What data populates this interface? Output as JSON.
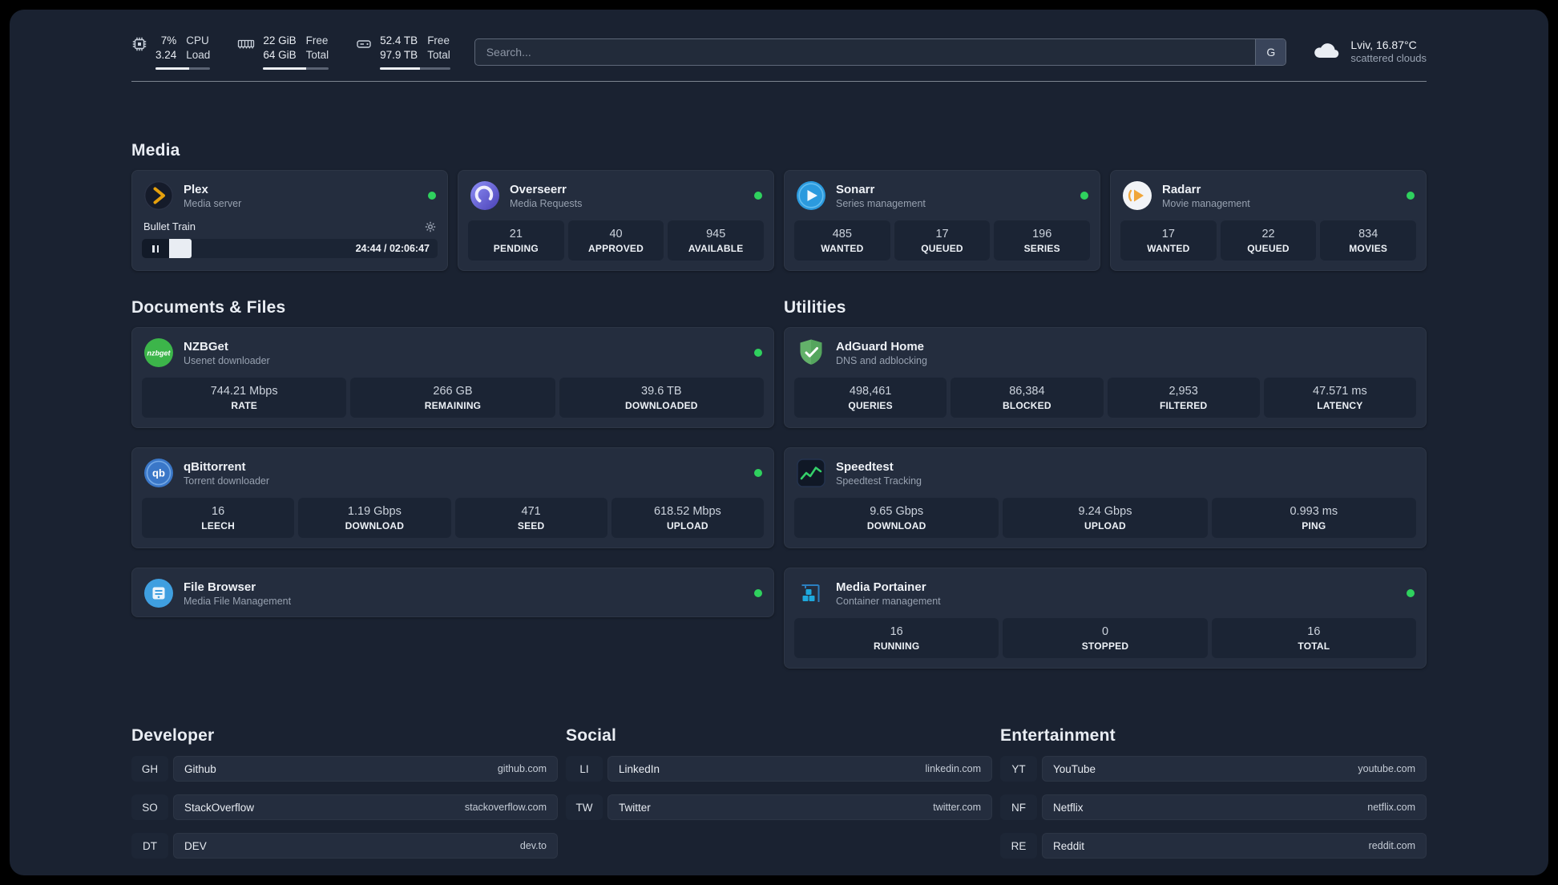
{
  "topbar": {
    "cpu": {
      "value_top": "7%",
      "value_bottom": "3.24",
      "label_top": "CPU",
      "label_bottom": "Load"
    },
    "memory": {
      "value_top": "22 GiB",
      "value_bottom": "64 GiB",
      "label_top": "Free",
      "label_bottom": "Total"
    },
    "disk": {
      "value_top": "52.4 TB",
      "value_bottom": "97.9 TB",
      "label_top": "Free",
      "label_bottom": "Total"
    },
    "search": {
      "placeholder": "Search...",
      "provider_button": "G"
    },
    "weather": {
      "location": "Lviv, 16.87°C",
      "condition": "scattered clouds"
    }
  },
  "media": {
    "title": "Media",
    "plex": {
      "name": "Plex",
      "description": "Media server",
      "now_playing": "Bullet Train",
      "progress_time": "24:44 / 02:06:47"
    },
    "overseerr": {
      "name": "Overseerr",
      "description": "Media Requests",
      "stats": [
        {
          "value": "21",
          "label": "PENDING"
        },
        {
          "value": "40",
          "label": "APPROVED"
        },
        {
          "value": "945",
          "label": "AVAILABLE"
        }
      ]
    },
    "sonarr": {
      "name": "Sonarr",
      "description": "Series management",
      "stats": [
        {
          "value": "485",
          "label": "WANTED"
        },
        {
          "value": "17",
          "label": "QUEUED"
        },
        {
          "value": "196",
          "label": "SERIES"
        }
      ]
    },
    "radarr": {
      "name": "Radarr",
      "description": "Movie management",
      "stats": [
        {
          "value": "17",
          "label": "WANTED"
        },
        {
          "value": "22",
          "label": "QUEUED"
        },
        {
          "value": "834",
          "label": "MOVIES"
        }
      ]
    }
  },
  "documents": {
    "title": "Documents & Files",
    "nzbget": {
      "name": "NZBGet",
      "description": "Usenet downloader",
      "icon_text": "nzbget",
      "stats": [
        {
          "value": "744.21 Mbps",
          "label": "RATE"
        },
        {
          "value": "266 GB",
          "label": "REMAINING"
        },
        {
          "value": "39.6 TB",
          "label": "DOWNLOADED"
        }
      ]
    },
    "qbittorrent": {
      "name": "qBittorrent",
      "description": "Torrent downloader",
      "icon_text": "qb",
      "stats": [
        {
          "value": "16",
          "label": "LEECH"
        },
        {
          "value": "1.19 Gbps",
          "label": "DOWNLOAD"
        },
        {
          "value": "471",
          "label": "SEED"
        },
        {
          "value": "618.52 Mbps",
          "label": "UPLOAD"
        }
      ]
    },
    "filebrowser": {
      "name": "File Browser",
      "description": "Media File Management"
    }
  },
  "utilities": {
    "title": "Utilities",
    "adguard": {
      "name": "AdGuard Home",
      "description": "DNS and adblocking",
      "stats": [
        {
          "value": "498,461",
          "label": "QUERIES"
        },
        {
          "value": "86,384",
          "label": "BLOCKED"
        },
        {
          "value": "2,953",
          "label": "FILTERED"
        },
        {
          "value": "47.571 ms",
          "label": "LATENCY"
        }
      ]
    },
    "speedtest": {
      "name": "Speedtest",
      "description": "Speedtest Tracking",
      "stats": [
        {
          "value": "9.65 Gbps",
          "label": "DOWNLOAD"
        },
        {
          "value": "9.24 Gbps",
          "label": "UPLOAD"
        },
        {
          "value": "0.993 ms",
          "label": "PING"
        }
      ]
    },
    "portainer": {
      "name": "Media Portainer",
      "description": "Container management",
      "stats": [
        {
          "value": "16",
          "label": "RUNNING"
        },
        {
          "value": "0",
          "label": "STOPPED"
        },
        {
          "value": "16",
          "label": "TOTAL"
        }
      ]
    }
  },
  "bookmarks": {
    "developer": {
      "title": "Developer",
      "items": [
        {
          "abbr": "GH",
          "name": "Github",
          "url": "github.com"
        },
        {
          "abbr": "SO",
          "name": "StackOverflow",
          "url": "stackoverflow.com"
        },
        {
          "abbr": "DT",
          "name": "DEV",
          "url": "dev.to"
        }
      ]
    },
    "social": {
      "title": "Social",
      "items": [
        {
          "abbr": "LI",
          "name": "LinkedIn",
          "url": "linkedin.com"
        },
        {
          "abbr": "TW",
          "name": "Twitter",
          "url": "twitter.com"
        }
      ]
    },
    "entertainment": {
      "title": "Entertainment",
      "items": [
        {
          "abbr": "YT",
          "name": "YouTube",
          "url": "youtube.com"
        },
        {
          "abbr": "NF",
          "name": "Netflix",
          "url": "netflix.com"
        },
        {
          "abbr": "RE",
          "name": "Reddit",
          "url": "reddit.com"
        }
      ]
    }
  },
  "colors": {
    "status_ok": "#2fd15e",
    "accent_green": "#35d06a",
    "plex_gold": "#e5a00d"
  }
}
